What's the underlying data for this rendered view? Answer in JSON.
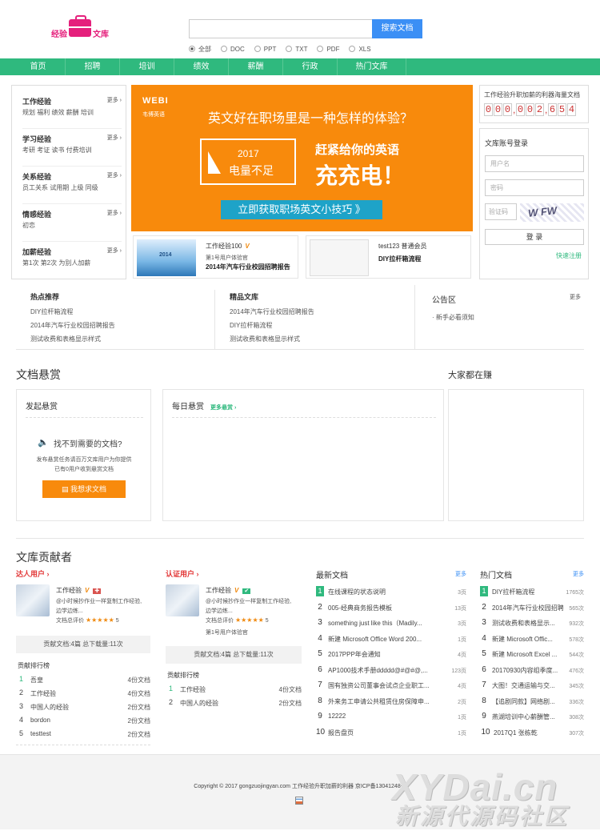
{
  "logo": {
    "left": "经验",
    "right": "文库"
  },
  "search": {
    "placeholder": "",
    "button": "搜索文档",
    "filters": [
      "全部",
      "DOC",
      "PPT",
      "TXT",
      "PDF",
      "XLS"
    ]
  },
  "nav": [
    "首页",
    "招聘",
    "培训",
    "绩效",
    "薪酬",
    "行政",
    "热门文库"
  ],
  "categories": [
    {
      "title": "工作经验",
      "more": "更多 ›",
      "subs": "规划  福利  绩效  薪酬  培训"
    },
    {
      "title": "学习经验",
      "more": "更多 ›",
      "subs": "考研  考证  读书  付费培训"
    },
    {
      "title": "关系经验",
      "more": "更多 ›",
      "subs": "员工关系  试用期  上级  同级"
    },
    {
      "title": "情感经验",
      "more": "更多 ›",
      "subs": "初恋"
    },
    {
      "title": "加薪经验",
      "more": "更多 ›",
      "subs": "第1次  第2次  为别人加薪"
    }
  ],
  "banner": {
    "brand": "WEBI",
    "brand_sub": "韦博英语",
    "headline": "英文好在职场里是一种怎样的体验？",
    "year": "2017",
    "shortage": "电量不足",
    "sub1": "赶紧给你的英语",
    "sub2": "充充电！",
    "cta": "立即获取职场英文小技巧 》"
  },
  "thumbcards": [
    {
      "name": "工作经验100",
      "badge": "V",
      "sub": "第1号用户体验官",
      "title": "2014年汽车行业校园招聘报告",
      "thumb_text": "2014"
    },
    {
      "name": "test123   普通会员",
      "badge": "",
      "sub": "",
      "title": "DIY拉杆箱流程",
      "thumb_text": ""
    }
  ],
  "counter": {
    "label": "工作经验升职加薪的利器海量文档",
    "digits": [
      "0",
      "0",
      "0",
      "0",
      "0",
      "2",
      "6",
      "5",
      "4"
    ]
  },
  "login": {
    "title": "文库账号登录",
    "username": "用户名",
    "password": "密码",
    "captcha": "验证码",
    "button": "登  录",
    "register": "快速注册"
  },
  "hot": {
    "title": "热点推荐",
    "items": [
      "DIY拉杆箱流程",
      "2014年汽车行业校园招聘报告",
      "测试收费和表格显示样式"
    ]
  },
  "fine": {
    "title": "精品文库",
    "items": [
      "2014年汽车行业校园招聘报告",
      "DIY拉杆箱流程",
      "测试收费和表格显示样式"
    ]
  },
  "notice": {
    "title": "公告区",
    "more": "更多",
    "items": [
      "· 新手必看须知"
    ]
  },
  "bounty": {
    "section": "文档悬赏",
    "earn": "大家都在赚",
    "launch": "发起悬赏",
    "cant_find": "找不到需要的文档?",
    "desc1": "发布悬赏任务请百万文库用户为你提供",
    "desc2": "已有0用户收到悬赏文档",
    "want_btn": "我想求文档",
    "daily": "每日悬赏",
    "daily_more": "更多悬赏 ›"
  },
  "contrib": {
    "section": "文库贡献者",
    "expert": {
      "title": "达人用户 ›",
      "name": "工作经验",
      "desc1": "@小时候抄作业一样复制工作经验,",
      "desc2": "边学边练...",
      "rating": "文档总评价",
      "stars": "★★★★★",
      "score": "5",
      "stats": "贡献文档:4篇   总下载量:11次",
      "rank_title": "贡献排行榜",
      "ranks": [
        {
          "n": "1",
          "name": "吾皇",
          "c": "4份文档"
        },
        {
          "n": "2",
          "name": "工作经验",
          "c": "4份文档"
        },
        {
          "n": "3",
          "name": "中国人的经验",
          "c": "2份文档"
        },
        {
          "n": "4",
          "name": "bordon",
          "c": "2份文档"
        },
        {
          "n": "5",
          "name": "testtest",
          "c": "2份文档"
        }
      ]
    },
    "certified": {
      "title": "认证用户 ›",
      "name": "工作经验",
      "desc1": "@小时候抄作业一样复制工作经验,",
      "desc2": "边学边练...",
      "rating": "文档总评价",
      "stars": "★★★★★",
      "score": "5",
      "sub": "第1号用户体验官",
      "stats": "贡献文档:4篇   总下载量:11次",
      "rank_title": "贡献排行榜",
      "ranks": [
        {
          "n": "1",
          "name": "工作经验",
          "c": "4份文档"
        },
        {
          "n": "2",
          "name": "中国人的经验",
          "c": "2份文档"
        }
      ]
    }
  },
  "latest": {
    "title": "最新文档",
    "more": "更多",
    "items": [
      {
        "n": "1",
        "name": "在线课程的状态说明",
        "c": "3页"
      },
      {
        "n": "2",
        "name": "005-经典商务报告模板",
        "c": "13页"
      },
      {
        "n": "3",
        "name": "something just like this（Madily...",
        "c": "3页"
      },
      {
        "n": "4",
        "name": "新建 Microsoft Office Word 200...",
        "c": "1页"
      },
      {
        "n": "5",
        "name": "2017PPP年会通知",
        "c": "4页"
      },
      {
        "n": "6",
        "name": "AP1000技术手册ddddd@#@#@,...",
        "c": "123页"
      },
      {
        "n": "7",
        "name": "国有独资公司董事会试点企业职工...",
        "c": "4页"
      },
      {
        "n": "8",
        "name": "外来务工申请公共租赁住房保障申...",
        "c": "2页"
      },
      {
        "n": "9",
        "name": "12222",
        "c": "1页"
      },
      {
        "n": "10",
        "name": "报告盘页",
        "c": "1页"
      }
    ]
  },
  "popular": {
    "title": "热门文档",
    "more": "更多",
    "items": [
      {
        "n": "1",
        "name": "DIY拉杆箱流程",
        "c": "1765次"
      },
      {
        "n": "2",
        "name": "2014年汽车行业校园招聘",
        "c": "565次"
      },
      {
        "n": "3",
        "name": "测试收费和表格显示...",
        "c": "932次"
      },
      {
        "n": "4",
        "name": "新建 Microsoft Offic...",
        "c": "578次"
      },
      {
        "n": "5",
        "name": "新建 Microsoft Excel ...",
        "c": "544次"
      },
      {
        "n": "6",
        "name": "20170930内容组季度...",
        "c": "476次"
      },
      {
        "n": "7",
        "name": "大图！交通运输与交...",
        "c": "345次"
      },
      {
        "n": "8",
        "name": "【追剧同款】网络剧...",
        "c": "336次"
      },
      {
        "n": "9",
        "name": "燕湖培训中心薪酬管...",
        "c": "308次"
      },
      {
        "n": "10",
        "name": "2017Q1 张栋乾",
        "c": "307次"
      }
    ]
  },
  "footer": {
    "text": "Copyright © 2017 gongzuojingyan.com 工作经验升职加薪的利器 京ICP备13041248号"
  },
  "watermark": {
    "line1": "XYDai.cn",
    "line2": "新源代源码社区"
  },
  "colors": {
    "green": "#2fb97e",
    "orange": "#f88a0c",
    "blue": "#3b8ff5",
    "pink": "#e5207c"
  }
}
